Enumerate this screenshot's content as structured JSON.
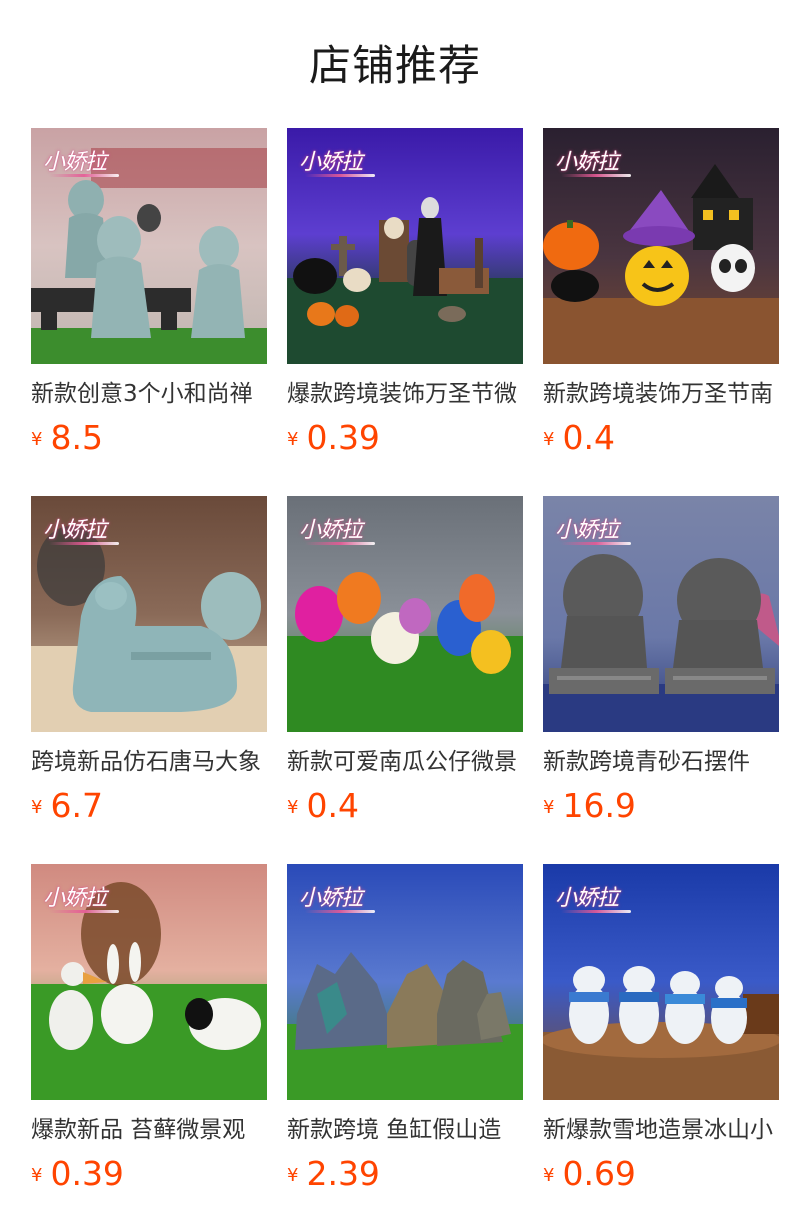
{
  "section": {
    "title": "店铺推荐"
  },
  "watermark_text": "小娇拉",
  "colors": {
    "price": "#ff4400",
    "title": "#1a1a1a",
    "product_name": "#333333"
  },
  "products": [
    {
      "name": "新款创意3个小和尚禅",
      "currency": "¥",
      "price": "8.5",
      "image": "stone-monk-figurines"
    },
    {
      "name": "爆款跨境装饰万圣节微",
      "currency": "¥",
      "price": "0.39",
      "image": "halloween-skeleton-scene"
    },
    {
      "name": "新款跨境装饰万圣节南",
      "currency": "¥",
      "price": "0.4",
      "image": "halloween-pumpkin-house"
    },
    {
      "name": "跨境新品仿石唐马大象",
      "currency": "¥",
      "price": "6.7",
      "image": "stone-horse-figurine"
    },
    {
      "name": "新款可爱南瓜公仔微景",
      "currency": "¥",
      "price": "0.4",
      "image": "cute-pumpkin-dolls"
    },
    {
      "name": "新款跨境青砂石摆件",
      "currency": "¥",
      "price": "16.9",
      "image": "stone-lion-pair"
    },
    {
      "name": "爆款新品 苔藓微景观",
      "currency": "¥",
      "price": "0.39",
      "image": "rabbit-cow-figurines"
    },
    {
      "name": "新款跨境 鱼缸假山造",
      "currency": "¥",
      "price": "2.39",
      "image": "aquarium-rockery"
    },
    {
      "name": "新爆款雪地造景冰山小",
      "currency": "¥",
      "price": "0.69",
      "image": "polar-bear-scarves"
    }
  ]
}
